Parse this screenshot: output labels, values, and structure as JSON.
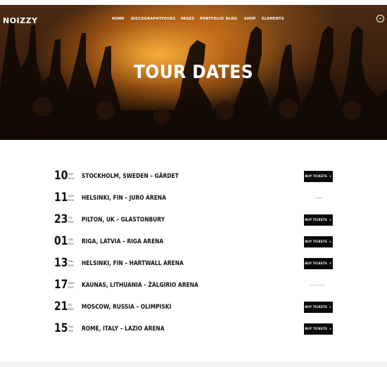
{
  "brand": {
    "name": "NOIZZY"
  },
  "nav": {
    "items": [
      {
        "label": "HOME"
      },
      {
        "label": "DISCOGRAPHY"
      },
      {
        "label": "TOURS"
      },
      {
        "label": "PAGES"
      },
      {
        "label": "PORTFOLIO"
      },
      {
        "label": "BLOG"
      },
      {
        "label": "SHOP"
      },
      {
        "label": "ELEMENTS"
      }
    ],
    "cart_icon": "circle-icon"
  },
  "hero": {
    "title": "TOUR DATES"
  },
  "tour": {
    "button_label": "BUY TICKETS",
    "button_arrow": ">",
    "dates": [
      {
        "day": "10",
        "weekday": "Sat",
        "month": "Nov",
        "venue": "STOCKHOLM, SWEDEN – GÄRDET",
        "action": "button"
      },
      {
        "day": "11",
        "weekday": "Sun",
        "month": "Nov",
        "venue": "HELSINKI, FIN – JURO ARENA",
        "action": "status",
        "status": "FREE"
      },
      {
        "day": "23",
        "weekday": "Fri",
        "month": "Nov",
        "venue": "PILTON, UK – GLASTONBURY",
        "action": "button"
      },
      {
        "day": "01",
        "weekday": "Sat",
        "month": "Dec",
        "venue": "RIGA, LATVIA – RIGA ARENA",
        "action": "button"
      },
      {
        "day": "13",
        "weekday": "Thu",
        "month": "Dec",
        "venue": "HELSINKI, FIN – HARTWALL ARENA",
        "action": "button"
      },
      {
        "day": "17",
        "weekday": "Mon",
        "month": "Dec",
        "venue": "KAUNAS, LITHUANIA – ŽALGIRIO ARENA",
        "action": "status",
        "status": "SOLD OUT"
      },
      {
        "day": "21",
        "weekday": "Fri",
        "month": "Dec",
        "venue": "MOSCOW, RUSSIA – OLIMPISKI",
        "action": "button"
      },
      {
        "day": "15",
        "weekday": "Tue",
        "month": "Jan",
        "venue": "ROME, ITALY – LAZIO ARENA",
        "action": "button"
      }
    ]
  },
  "colors": {
    "button_bg": "#0a0a0a",
    "button_text": "#ffffff",
    "hero_glow": "#f0a030"
  }
}
